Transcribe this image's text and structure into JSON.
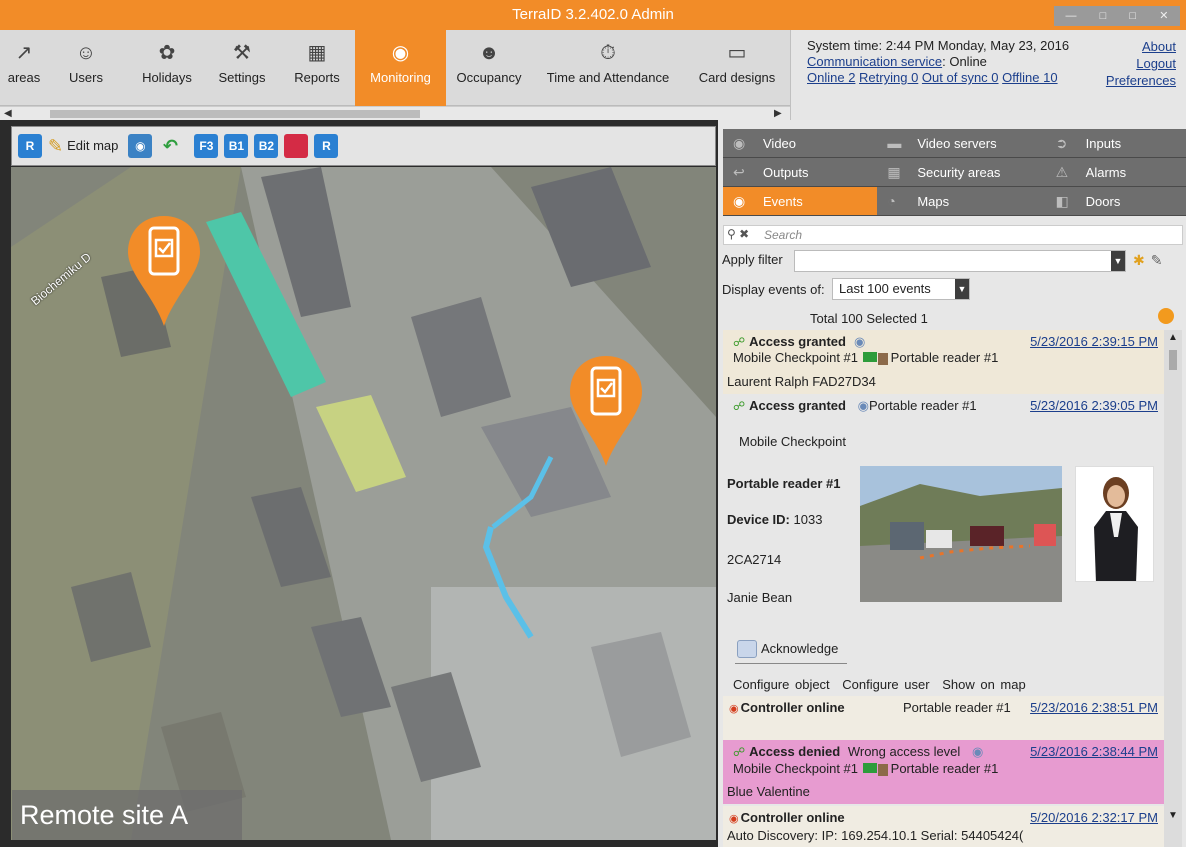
{
  "window": {
    "title": "TerraID 3.2.402.0 Admin"
  },
  "ribbon": {
    "items": [
      {
        "label": "areas",
        "icon": "areas-icon"
      },
      {
        "label": "Users",
        "icon": "users-icon"
      },
      {
        "label": "Holidays",
        "icon": "holidays-icon"
      },
      {
        "label": "Settings",
        "icon": "settings-icon"
      },
      {
        "label": "Reports",
        "icon": "reports-icon"
      },
      {
        "label": "Monitoring",
        "icon": "eye-icon"
      },
      {
        "label": "Occupancy",
        "icon": "occupancy-icon"
      },
      {
        "label": "Time and Attendance",
        "icon": "stopwatch-icon"
      },
      {
        "label": "Card designs",
        "icon": "card-designs-icon"
      }
    ],
    "active": "Monitoring"
  },
  "status": {
    "system_time": "System time: 2:44 PM Monday, May 23, 2016",
    "comm_label": "Communication service",
    "comm_value": ": Online",
    "online": "Online 2",
    "retrying": "Retrying 0",
    "out_of_sync": "Out of sync 0",
    "offline": "Offline 10",
    "about": "About",
    "logout": "Logout",
    "preferences": "Preferences"
  },
  "map_toolbar": {
    "r_button": "R",
    "edit_map": "Edit map",
    "f3": "F3",
    "b1": "B1",
    "b2": "B2",
    "r_button2": "R"
  },
  "map": {
    "street_label": "Biochemiku D",
    "site_label": "Remote site A",
    "pins": [
      {
        "name": "mobile-checkpoint-pin-1"
      },
      {
        "name": "mobile-checkpoint-pin-2"
      }
    ]
  },
  "panel": {
    "tabs_row1": [
      "Video",
      "Video servers",
      "Inputs"
    ],
    "tabs_row2": [
      "Outputs",
      "Security areas",
      "Alarms"
    ],
    "tabs_row3": [
      "Events",
      "Maps",
      "Doors"
    ],
    "active_tab": "Events",
    "search_placeholder": "Search",
    "apply_filter": "Apply filter",
    "display_events_of": "Display events of:",
    "display_events_value": "Last 100 events",
    "totals": "Total 100   Selected 1"
  },
  "events": [
    {
      "title": "Access granted",
      "datetime": "5/23/2016 2:39:15 PM",
      "line2_a": "Mobile Checkpoint #1",
      "line2_b": "Portable reader #1",
      "line3": "Laurent Ralph FAD27D34",
      "bg": "#efe8d8"
    },
    {
      "title": "Access granted",
      "reader": "Portable reader #1",
      "datetime": "5/23/2016 2:39:05 PM",
      "location": "Mobile Checkpoint",
      "detail_reader": "Portable reader #1",
      "device_label": "Device ID:",
      "device_id": "1033",
      "card": "2CA2714",
      "user": "Janie Bean",
      "acknowledge": "Acknowledge",
      "action1": "Configure object",
      "action2": "Configure user",
      "action3": "Show on map"
    },
    {
      "title": "Controller online",
      "reader": "Portable reader #1",
      "datetime": "5/23/2016 2:38:51 PM",
      "bg": "#f0ece2"
    },
    {
      "title": "Access denied",
      "reason": "Wrong access level",
      "datetime": "5/23/2016 2:38:44 PM",
      "line2_a": "Mobile Checkpoint #1",
      "line2_b": "Portable reader #1",
      "line3": "Blue Valentine",
      "bg": "#e79bd0"
    },
    {
      "title": "Controller online",
      "datetime": "5/20/2016 2:32:17 PM",
      "line2": "Auto Discovery: IP: 169.254.10.1 Serial: 54405424(",
      "bg": "#f0ece2"
    }
  ],
  "colors": {
    "accent": "#f28c28",
    "denied_bg": "#e79bd0",
    "tab_bg": "#6e6e6e"
  }
}
